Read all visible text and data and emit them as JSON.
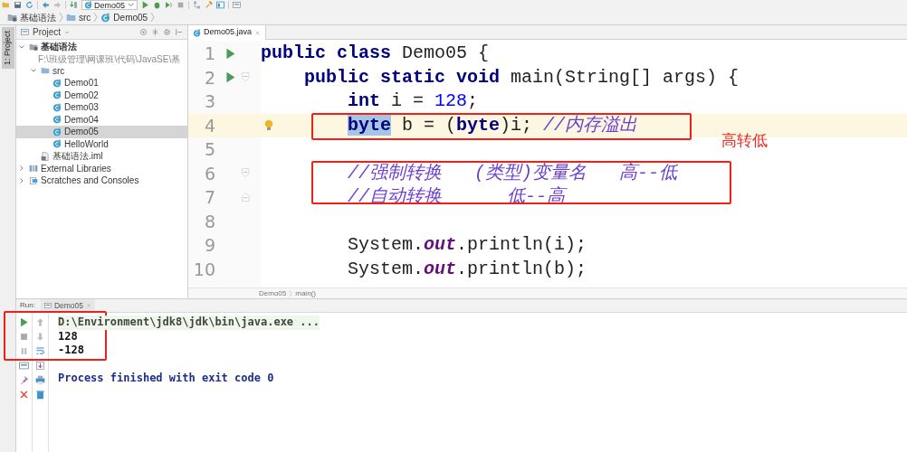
{
  "toolbar": {
    "run_config": "Demo05"
  },
  "breadcrumbs": [
    {
      "label": "基础语法",
      "kind": "module"
    },
    {
      "label": "src",
      "kind": "folder"
    },
    {
      "label": "Demo05",
      "kind": "class"
    }
  ],
  "side_tab": {
    "label": "1: Project",
    "selected": true
  },
  "project_panel": {
    "title": "Project",
    "tree": [
      {
        "label": "基础语法",
        "path": "F:\\班级管理\\网课班\\代码\\JavaSE\\基",
        "kind": "module",
        "expanded": true,
        "selected": false,
        "children": [
          {
            "label": "src",
            "kind": "folder",
            "expanded": true,
            "selected": false,
            "children": [
              {
                "label": "Demo01",
                "kind": "class",
                "selected": false
              },
              {
                "label": "Demo02",
                "kind": "class",
                "selected": false
              },
              {
                "label": "Demo03",
                "kind": "class",
                "selected": false
              },
              {
                "label": "Demo04",
                "kind": "class",
                "selected": false
              },
              {
                "label": "Demo05",
                "kind": "class",
                "selected": true
              },
              {
                "label": "HelloWorld",
                "kind": "class",
                "selected": false
              }
            ]
          },
          {
            "label": "基础语法.iml",
            "kind": "iml",
            "selected": false
          }
        ]
      },
      {
        "label": "External Libraries",
        "kind": "libraries",
        "expanded": false,
        "selected": false
      },
      {
        "label": "Scratches and Consoles",
        "kind": "scratches",
        "expanded": false,
        "selected": false
      }
    ]
  },
  "editor": {
    "tab": {
      "label": "Demo05.java",
      "selected": true
    },
    "lines": [
      {
        "number": "1",
        "run": true,
        "fold_start": false,
        "fold_end": false,
        "current": false,
        "boxed": false,
        "tokens": [
          {
            "text": "public ",
            "kind": "keyword"
          },
          {
            "text": "class",
            "kind": "keyword"
          },
          {
            "text": " Demo05 {",
            "kind": "plain"
          }
        ]
      },
      {
        "number": "2",
        "run": true,
        "fold_start": true,
        "fold_end": false,
        "current": false,
        "boxed": false,
        "tokens": [
          {
            "text": "    public static void",
            "kind": "keyword"
          },
          {
            "text": " main(String[] args) {",
            "kind": "plain"
          }
        ]
      },
      {
        "number": "3",
        "run": false,
        "fold_start": false,
        "fold_end": false,
        "current": false,
        "boxed": false,
        "tokens": [
          {
            "text": "        int",
            "kind": "keyword"
          },
          {
            "text": " i = ",
            "kind": "plain"
          },
          {
            "text": "128",
            "kind": "number"
          },
          {
            "text": ";",
            "kind": "plain"
          }
        ]
      },
      {
        "number": "4",
        "run": false,
        "fold_start": false,
        "fold_end": false,
        "current": true,
        "boxed": true,
        "tokens": [
          {
            "text": "        byte",
            "kind": "selected_keyword"
          },
          {
            "text": " b = (",
            "kind": "plain"
          },
          {
            "text": "byte",
            "kind": "keyword"
          },
          {
            "text": ")i; ",
            "kind": "plain"
          },
          {
            "text": "//内存溢出",
            "kind": "comment"
          }
        ]
      },
      {
        "number": "5",
        "run": false,
        "fold_start": false,
        "fold_end": false,
        "current": false,
        "boxed": false
      },
      {
        "number": "6",
        "run": false,
        "fold_start": true,
        "fold_end": false,
        "current": false,
        "boxed": true,
        "tokens": [
          {
            "text": "        //强制转换   (类型)变量名   高--低",
            "kind": "comment"
          }
        ]
      },
      {
        "number": "7",
        "run": false,
        "fold_start": false,
        "fold_end": true,
        "current": false,
        "boxed": true,
        "tokens": [
          {
            "text": "        //自动转换      低--高",
            "kind": "comment"
          }
        ]
      },
      {
        "number": "8",
        "run": false,
        "fold_start": false,
        "fold_end": false,
        "current": false,
        "boxed": false
      },
      {
        "number": "9",
        "run": false,
        "fold_start": false,
        "fold_end": false,
        "current": false,
        "boxed": false,
        "tokens": [
          {
            "text": "        System.",
            "kind": "plain"
          },
          {
            "text": "out",
            "kind": "static_field"
          },
          {
            "text": ".println(i);",
            "kind": "plain"
          }
        ]
      },
      {
        "number": "10",
        "run": false,
        "fold_start": false,
        "fold_end": false,
        "current": false,
        "boxed": false,
        "tokens": [
          {
            "text": "        System.",
            "kind": "plain"
          },
          {
            "text": "out",
            "kind": "static_field"
          },
          {
            "text": ".println(b);",
            "kind": "plain"
          }
        ]
      }
    ],
    "breadcrumbs": [
      "Demo05",
      "main()"
    ]
  },
  "run_panel": {
    "label": "Run:",
    "tab": "Demo05",
    "output": [
      {
        "text": "D:\\Environment\\jdk8\\jdk\\bin\\java.exe ...",
        "kind": "command",
        "boxed": true
      },
      {
        "text": "128",
        "kind": "stdout",
        "boxed": true
      },
      {
        "text": "-128",
        "kind": "stdout",
        "boxed": true
      },
      {
        "text": "Process finished with exit code 0",
        "kind": "exit",
        "boxed": false
      }
    ]
  },
  "annotations": {
    "note": "高转低"
  }
}
